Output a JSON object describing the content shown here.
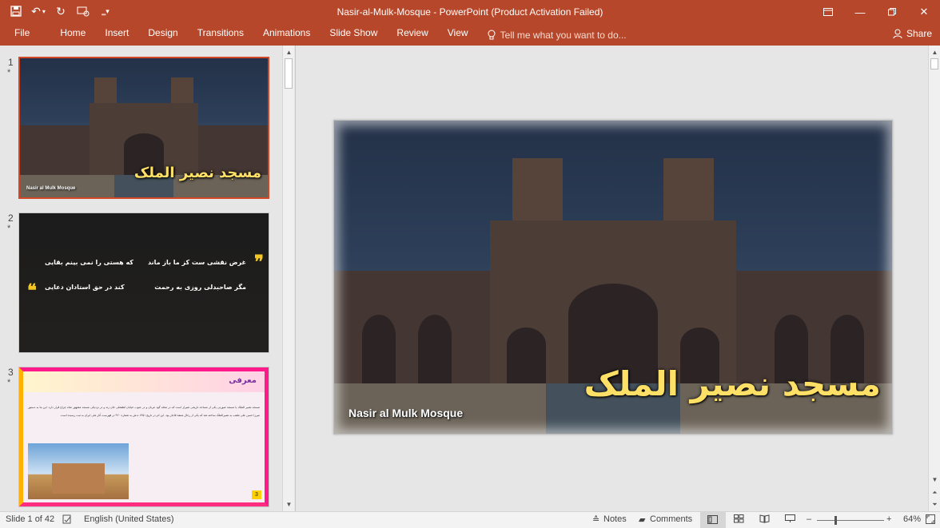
{
  "window": {
    "title": "Nasir-al-Mulk-Mosque - PowerPoint (Product Activation Failed)"
  },
  "ribbon": {
    "tabs": [
      "File",
      "Home",
      "Insert",
      "Design",
      "Transitions",
      "Animations",
      "Slide Show",
      "Review",
      "View"
    ],
    "tell_me": "Tell me what you want to do...",
    "share": "Share"
  },
  "thumbnails": [
    {
      "number": "1",
      "marker": "*",
      "title_ar": "مسجد نصیر الملک",
      "subtitle": "Nasir al Mulk Mosque"
    },
    {
      "number": "2",
      "marker": "*",
      "lines": [
        "غرض نقشی ست کز ما باز ماند",
        "که هستی را نمی بینم بقایی",
        "مگر صاحبدلی روزی به رحمت",
        "کند در حق استادان دعایی"
      ]
    },
    {
      "number": "3",
      "marker": "*",
      "header_ar": "معرفی",
      "para": "مسجد نصیر الملک یا مسجد صورتی یکی از مساجد تاریخی شیراز است که در محله گود عربان و در جنوب خیابان لطفعلی خان زند و در نزدیکی مسجد مشهور شاه چراغ قرار دارد. این بنا به دستور میرزا حسن علی ملقب به نصیرالملک ساخته شد که یکی از رجال متنفذ قاجار بود. این اثر در تاریخ ۱۳۵۱ ه.ش به شماره ۹۲۰ در فهرست آثار ملی ایران به ثبت رسیده است.",
      "page": "3"
    }
  ],
  "main_slide": {
    "title_ar": "مسجد نصیر الملک",
    "subtitle": "Nasir al Mulk Mosque"
  },
  "status": {
    "slide": "Slide 1 of 42",
    "language": "English (United States)",
    "notes": "Notes",
    "comments": "Comments",
    "zoom": "64%"
  },
  "colors": {
    "accent": "#b7472a",
    "selection": "#d24726"
  }
}
